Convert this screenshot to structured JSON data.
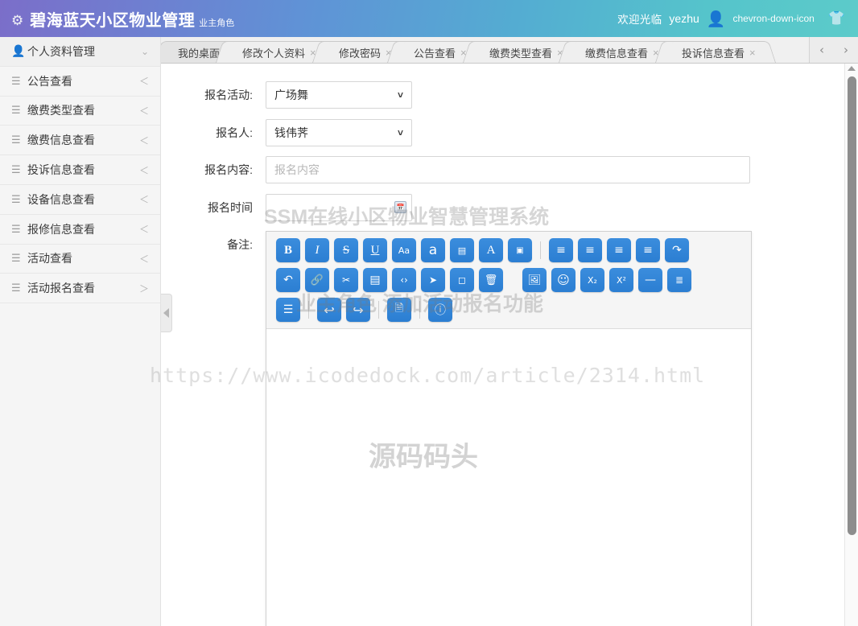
{
  "header": {
    "brand_icon": "gear-icon",
    "title": "碧海蓝天小区物业管理",
    "subtitle": "业主角色",
    "welcome": "欢迎光临",
    "username": "yezhu",
    "avatar_icon": "user-icon",
    "caret_icon": "chevron-down-icon",
    "theme_icon": "shirt-icon"
  },
  "sidebar": {
    "items": [
      {
        "label": "个人资料管理",
        "icon": "person-icon",
        "arrow": "⌄"
      },
      {
        "label": "公告查看",
        "icon": "list-icon",
        "arrow": "＜"
      },
      {
        "label": "缴费类型查看",
        "icon": "list-icon",
        "arrow": "＜"
      },
      {
        "label": "缴费信息查看",
        "icon": "list-icon",
        "arrow": "＜"
      },
      {
        "label": "投诉信息查看",
        "icon": "list-icon",
        "arrow": "＜"
      },
      {
        "label": "设备信息查看",
        "icon": "list-icon",
        "arrow": "＜"
      },
      {
        "label": "报修信息查看",
        "icon": "list-icon",
        "arrow": "＜"
      },
      {
        "label": "活动查看",
        "icon": "list-icon",
        "arrow": "＜"
      },
      {
        "label": "活动报名查看",
        "icon": "list-icon",
        "arrow": "＞"
      }
    ]
  },
  "tabs": {
    "items": [
      {
        "label": "我的桌面",
        "closable": false,
        "active": true
      },
      {
        "label": "修改个人资料",
        "closable": true,
        "active": false
      },
      {
        "label": "修改密码",
        "closable": true,
        "active": false
      },
      {
        "label": "公告查看",
        "closable": true,
        "active": false
      },
      {
        "label": "缴费类型查看",
        "closable": true,
        "active": false
      },
      {
        "label": "缴费信息查看",
        "closable": true,
        "active": false
      },
      {
        "label": "投诉信息查看",
        "closable": true,
        "active": false
      }
    ],
    "close_glyph": "×",
    "nav_prev": "‹",
    "nav_next": "›"
  },
  "form": {
    "activity": {
      "label": "报名活动:",
      "value": "广场舞"
    },
    "applicant": {
      "label": "报名人:",
      "value": "钱伟荠"
    },
    "content": {
      "label": "报名内容:",
      "value": "",
      "placeholder": "报名内容"
    },
    "time": {
      "label": "报名时间",
      "value": "",
      "placeholder": "",
      "picker_icon": "calendar-icon"
    },
    "remark": {
      "label": "备注:"
    }
  },
  "editor": {
    "toolbar_rows": [
      [
        {
          "name": "bold-icon",
          "glyph": "B",
          "style": "bold-serif"
        },
        {
          "name": "italic-icon",
          "glyph": "I",
          "style": "italic-serif"
        },
        {
          "name": "strikethrough-icon",
          "glyph": "S̶",
          "style": "serif"
        },
        {
          "name": "underline-icon",
          "glyph": "U̲",
          "style": "serif"
        },
        {
          "name": "font-size-icon",
          "glyph": "Aa",
          "style": "small-sans"
        },
        {
          "name": "font-family-icon",
          "glyph": "a",
          "style": "sans"
        },
        {
          "name": "highlight-icon",
          "glyph": "H",
          "style": "boxed"
        },
        {
          "name": "text-color-icon",
          "glyph": "A",
          "style": "serif"
        },
        {
          "name": "background-color-icon",
          "glyph": "B",
          "style": "boxed-invert"
        },
        {
          "name": "separator",
          "glyph": "",
          "style": "sep"
        },
        {
          "name": "align-left-icon",
          "glyph": "≡",
          "style": "sans"
        },
        {
          "name": "align-center-icon",
          "glyph": "≡",
          "style": "sans"
        },
        {
          "name": "align-right-icon",
          "glyph": "≡",
          "style": "sans"
        },
        {
          "name": "align-justify-icon",
          "glyph": "≡",
          "style": "sans"
        },
        {
          "name": "indent-icon",
          "glyph": "≡",
          "style": "sans"
        }
      ],
      [
        {
          "name": "outdent-icon",
          "glyph": "≡",
          "style": "sans"
        },
        {
          "name": "link-icon",
          "glyph": "🔗",
          "style": "sans"
        },
        {
          "name": "unlink-icon",
          "glyph": "⛓",
          "style": "sans"
        },
        {
          "name": "insert-table-icon",
          "glyph": "▤",
          "style": "sans"
        },
        {
          "name": "code-icon",
          "glyph": "‹›",
          "style": "sans"
        },
        {
          "name": "cursor-icon",
          "glyph": "➤",
          "style": "sans"
        },
        {
          "name": "fullscreen-icon",
          "glyph": "⛶",
          "style": "sans"
        },
        {
          "name": "clear-format-icon",
          "glyph": "🗑",
          "style": "sans"
        },
        {
          "name": "separator",
          "glyph": "",
          "style": "gap"
        },
        {
          "name": "insert-image-icon",
          "glyph": "🖼",
          "style": "sans"
        },
        {
          "name": "emoji-icon",
          "glyph": "☺",
          "style": "sans"
        },
        {
          "name": "subscript-icon",
          "glyph": "X₂",
          "style": "small-sans"
        },
        {
          "name": "superscript-icon",
          "glyph": "X²",
          "style": "small-sans"
        },
        {
          "name": "horizontal-rule-icon",
          "glyph": "—",
          "style": "sans"
        },
        {
          "name": "ordered-list-icon",
          "glyph": "≔",
          "style": "sans"
        }
      ],
      [
        {
          "name": "unordered-list-icon",
          "glyph": "☰",
          "style": "sans"
        },
        {
          "name": "separator",
          "glyph": "",
          "style": "sep"
        },
        {
          "name": "undo-icon",
          "glyph": "↩",
          "style": "sans"
        },
        {
          "name": "redo-icon",
          "glyph": "↪",
          "style": "sans"
        },
        {
          "name": "separator",
          "glyph": "",
          "style": "sep"
        },
        {
          "name": "source-code-icon",
          "glyph": "🗎",
          "style": "sans"
        },
        {
          "name": "separator",
          "glyph": "",
          "style": "sep"
        },
        {
          "name": "help-icon",
          "glyph": "?",
          "style": "circle"
        }
      ]
    ],
    "body_text": ""
  },
  "watermarks": {
    "title": "SSM在线小区物业智慧管理系统",
    "subtitle": "业主角色 添加活动报名功能",
    "url": "https://www.icodedock.com/article/2314.html",
    "brand": "源码码头"
  },
  "collapse": {
    "icon": "triangle-left-icon"
  },
  "scrollbar": {
    "up_icon": "triangle-up-icon"
  }
}
